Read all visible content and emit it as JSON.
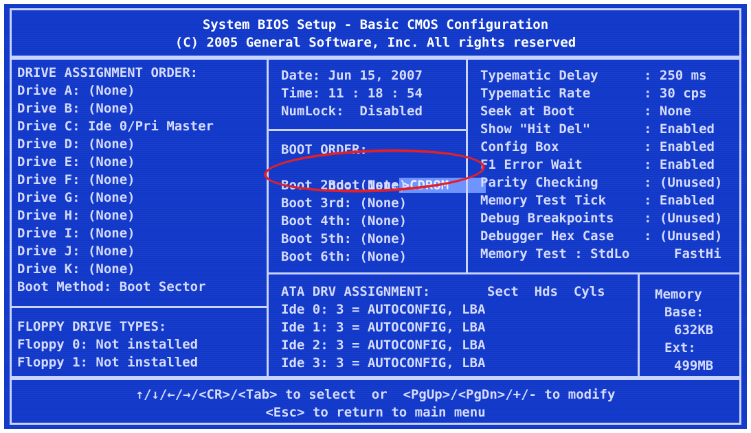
{
  "header": {
    "line1": "System BIOS Setup - Basic CMOS Configuration",
    "line2": "(C) 2005 General Software, Inc. All rights reserved"
  },
  "drive_assignment": {
    "heading": "DRIVE ASSIGNMENT ORDER:",
    "drives": [
      "Drive A: (None)",
      "Drive B: (None)",
      "Drive C: Ide 0/Pri Master",
      "Drive D: (None)",
      "Drive E: (None)",
      "Drive F: (None)",
      "Drive G: (None)",
      "Drive H: (None)",
      "Drive I: (None)",
      "Drive J: (None)",
      "Drive K: (None)"
    ],
    "boot_method": "Boot Method: Boot Sector"
  },
  "floppy": {
    "heading": "FLOPPY DRIVE TYPES:",
    "items": [
      "Floppy 0: Not installed",
      "Floppy 1: Not installed"
    ]
  },
  "datetime": {
    "date": "Date: Jun 15, 2007",
    "time": "Time: 11 : 18 : 54",
    "numlock": "NumLock:  Disabled"
  },
  "boot_order": {
    "heading": "BOOT ORDER:",
    "first_label": "Boot 1st:",
    "first_value": ">CDROM",
    "items": [
      "Boot 2nd: (None)",
      "Boot 3rd: (None)",
      "Boot 4th: (None)",
      "Boot 5th: (None)",
      "Boot 6th: (None)"
    ]
  },
  "settings": [
    {
      "label": "Typematic Delay",
      "value": ": 250 ms"
    },
    {
      "label": "Typematic Rate",
      "value": ": 30 cps"
    },
    {
      "label": "Seek at Boot",
      "value": ": None"
    },
    {
      "label": "Show \"Hit Del\"",
      "value": ": Enabled"
    },
    {
      "label": "Config Box",
      "value": ": Enabled"
    },
    {
      "label": "F1 Error Wait",
      "value": ": Enabled"
    },
    {
      "label": "Parity Checking",
      "value": ": (Unused)"
    },
    {
      "label": "Memory Test Tick",
      "value": ": Enabled"
    },
    {
      "label": "Debug Breakpoints",
      "value": ": (Unused)"
    },
    {
      "label": "Debugger Hex Case",
      "value": ": (Unused)"
    },
    {
      "label": "Memory Test : StdLo",
      "value": "FastHi"
    }
  ],
  "ata": {
    "heading": "ATA DRV ASSIGNMENT:",
    "cols": "Sect  Hds  Cyls",
    "items": [
      "Ide 0: 3 = AUTOCONFIG, LBA",
      "Ide 1: 3 = AUTOCONFIG, LBA",
      "Ide 2: 3 = AUTOCONFIG, LBA",
      "Ide 3: 3 = AUTOCONFIG, LBA"
    ]
  },
  "memory": {
    "heading": "Memory",
    "base_label": "Base:",
    "base_value": "632KB",
    "ext_label": "Ext:",
    "ext_value": "499MB"
  },
  "footer": {
    "line1": "↑/↓/←/→/<CR>/<Tab> to select  or  <PgUp>/<PgDn>/+/- to modify",
    "line2": "<Esc> to return to main menu"
  },
  "colors": {
    "background": "#1138c8",
    "border": "#c9d3ff",
    "text": "#d6dcff",
    "selection": "#6f93ff",
    "annotation": "#e0202a"
  }
}
